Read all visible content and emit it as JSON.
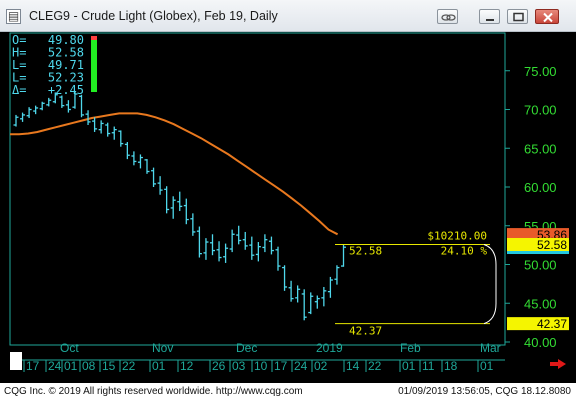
{
  "window": {
    "title": "CLEG9 - Crude Light (Globex), Feb 19, Daily"
  },
  "ohlc_box": [
    {
      "label": "O=",
      "value": "49.80"
    },
    {
      "label": "H=",
      "value": "52.58"
    },
    {
      "label": "L=",
      "value": "49.71"
    },
    {
      "label": "L=",
      "value": "52.23"
    },
    {
      "label": "Δ=",
      "value": "+2.45"
    }
  ],
  "annotations": {
    "dollar_value": "$10210.00",
    "top_price": "52.58",
    "percent": "24.10 %",
    "bottom_price": "42.37"
  },
  "price_tags": [
    {
      "text": "53.86",
      "value": 53.86,
      "bg": "#e85a2a",
      "fg": "#000000"
    },
    {
      "text": "52.58",
      "value": 52.58,
      "bg": "#f5f500",
      "fg": "#000000"
    },
    {
      "text": "42.37",
      "value": 42.37,
      "bg": "#f5f500",
      "fg": "#000000"
    }
  ],
  "footer": {
    "left": "CQG Inc. © 2019 All rights reserved worldwide. http://www.cqg.com",
    "right": "01/09/2019 13:56:05, CQG 18.12.8080"
  },
  "colors": {
    "background": "#000000",
    "bars": "#4fd8ec",
    "moving_average": "#e8781e",
    "axis_text": "#33dd33",
    "annotation": "#e8e800",
    "panel_border": "#1fa89a"
  },
  "chart_data": {
    "type": "ohlc",
    "y_range": [
      40,
      77
    ],
    "y_ticks": [
      40,
      45,
      50,
      55,
      60,
      65,
      70,
      75
    ],
    "y_tick_labels": [
      "40.00",
      "45.00",
      "50.00",
      "55.00",
      "60.00",
      "65.00",
      "70.00",
      "75.00"
    ],
    "month_labels": [
      "Oct",
      "Nov",
      "Dec",
      "2019",
      "Feb",
      "Mar"
    ],
    "day_labels": [
      "17",
      "24",
      "01",
      "08",
      "15",
      "22",
      "01",
      "12",
      "26",
      "03",
      "10",
      "17",
      "24",
      "02",
      "14",
      "22",
      "01",
      "11",
      "18",
      "01"
    ],
    "bars": [
      {
        "h": 69.3,
        "l": 67.8,
        "o": 68.0,
        "c": 69.0
      },
      {
        "h": 69.6,
        "l": 68.4,
        "o": 68.8,
        "c": 69.3
      },
      {
        "h": 70.3,
        "l": 68.9,
        "o": 69.2,
        "c": 70.0
      },
      {
        "h": 70.5,
        "l": 69.4,
        "o": 69.8,
        "c": 70.2
      },
      {
        "h": 71.0,
        "l": 69.9,
        "o": 70.1,
        "c": 70.8
      },
      {
        "h": 71.5,
        "l": 70.4,
        "o": 70.6,
        "c": 71.2
      },
      {
        "h": 72.2,
        "l": 70.8,
        "o": 71.0,
        "c": 71.9
      },
      {
        "h": 71.8,
        "l": 70.2,
        "o": 71.6,
        "c": 70.5
      },
      {
        "h": 71.2,
        "l": 69.6,
        "o": 70.6,
        "c": 70.0
      },
      {
        "h": 72.4,
        "l": 70.1,
        "o": 70.3,
        "c": 72.0
      },
      {
        "h": 71.9,
        "l": 69.0,
        "o": 71.7,
        "c": 69.3
      },
      {
        "h": 69.9,
        "l": 68.0,
        "o": 69.4,
        "c": 68.4
      },
      {
        "h": 69.0,
        "l": 67.1,
        "o": 68.5,
        "c": 67.5
      },
      {
        "h": 68.6,
        "l": 66.9,
        "o": 67.4,
        "c": 68.2
      },
      {
        "h": 68.3,
        "l": 66.5,
        "o": 68.0,
        "c": 66.9
      },
      {
        "h": 67.8,
        "l": 66.1,
        "o": 67.0,
        "c": 67.4
      },
      {
        "h": 67.3,
        "l": 65.2,
        "o": 67.2,
        "c": 65.6
      },
      {
        "h": 65.8,
        "l": 63.6,
        "o": 65.5,
        "c": 64.1
      },
      {
        "h": 64.6,
        "l": 62.8,
        "o": 64.0,
        "c": 63.3
      },
      {
        "h": 64.2,
        "l": 62.4,
        "o": 63.2,
        "c": 63.8
      },
      {
        "h": 63.6,
        "l": 61.7,
        "o": 63.5,
        "c": 62.0
      },
      {
        "h": 62.5,
        "l": 60.0,
        "o": 62.1,
        "c": 60.4
      },
      {
        "h": 61.4,
        "l": 59.0,
        "o": 60.5,
        "c": 59.6
      },
      {
        "h": 60.1,
        "l": 56.6,
        "o": 59.7,
        "c": 57.1
      },
      {
        "h": 58.8,
        "l": 55.9,
        "o": 57.3,
        "c": 58.3
      },
      {
        "h": 59.4,
        "l": 56.9,
        "o": 58.1,
        "c": 57.5
      },
      {
        "h": 58.5,
        "l": 55.2,
        "o": 57.6,
        "c": 55.8
      },
      {
        "h": 56.6,
        "l": 53.7,
        "o": 55.9,
        "c": 54.2
      },
      {
        "h": 54.9,
        "l": 50.9,
        "o": 54.3,
        "c": 51.4
      },
      {
        "h": 53.4,
        "l": 50.6,
        "o": 51.5,
        "c": 52.9
      },
      {
        "h": 53.9,
        "l": 51.2,
        "o": 52.8,
        "c": 51.8
      },
      {
        "h": 53.0,
        "l": 50.4,
        "o": 51.9,
        "c": 50.9
      },
      {
        "h": 52.7,
        "l": 50.2,
        "o": 51.0,
        "c": 52.1
      },
      {
        "h": 54.5,
        "l": 51.6,
        "o": 52.0,
        "c": 53.9
      },
      {
        "h": 55.0,
        "l": 52.6,
        "o": 53.8,
        "c": 53.1
      },
      {
        "h": 54.2,
        "l": 51.9,
        "o": 53.2,
        "c": 52.4
      },
      {
        "h": 53.6,
        "l": 50.6,
        "o": 52.5,
        "c": 51.2
      },
      {
        "h": 52.9,
        "l": 50.4,
        "o": 51.3,
        "c": 52.3
      },
      {
        "h": 53.9,
        "l": 51.6,
        "o": 52.2,
        "c": 53.2
      },
      {
        "h": 53.6,
        "l": 51.3,
        "o": 53.0,
        "c": 51.8
      },
      {
        "h": 52.3,
        "l": 49.2,
        "o": 51.9,
        "c": 49.8
      },
      {
        "h": 49.9,
        "l": 46.6,
        "o": 49.6,
        "c": 47.1
      },
      {
        "h": 47.9,
        "l": 45.2,
        "o": 47.0,
        "c": 45.6
      },
      {
        "h": 47.3,
        "l": 45.1,
        "o": 45.7,
        "c": 46.8
      },
      {
        "h": 46.8,
        "l": 42.8,
        "o": 46.2,
        "c": 43.2
      },
      {
        "h": 46.4,
        "l": 43.6,
        "o": 43.8,
        "c": 45.9
      },
      {
        "h": 46.0,
        "l": 44.3,
        "o": 45.2,
        "c": 45.6
      },
      {
        "h": 47.1,
        "l": 44.6,
        "o": 45.7,
        "c": 46.6
      },
      {
        "h": 48.4,
        "l": 45.7,
        "o": 46.5,
        "c": 48.0
      },
      {
        "h": 49.9,
        "l": 47.4,
        "o": 48.1,
        "c": 49.6
      },
      {
        "h": 52.58,
        "l": 49.71,
        "o": 49.8,
        "c": 52.23
      }
    ],
    "moving_average": [
      66.8,
      66.8,
      66.9,
      67.1,
      67.4,
      67.7,
      68.0,
      68.3,
      68.6,
      68.9,
      69.1,
      69.3,
      69.5,
      69.5,
      69.5,
      69.3,
      69.0,
      68.6,
      68.1,
      67.5,
      66.9,
      66.3,
      65.6,
      64.9,
      64.2,
      63.4,
      62.6,
      61.8,
      61.0,
      60.2,
      59.4,
      58.5,
      57.6,
      56.6,
      55.6,
      54.5,
      53.9
    ]
  }
}
